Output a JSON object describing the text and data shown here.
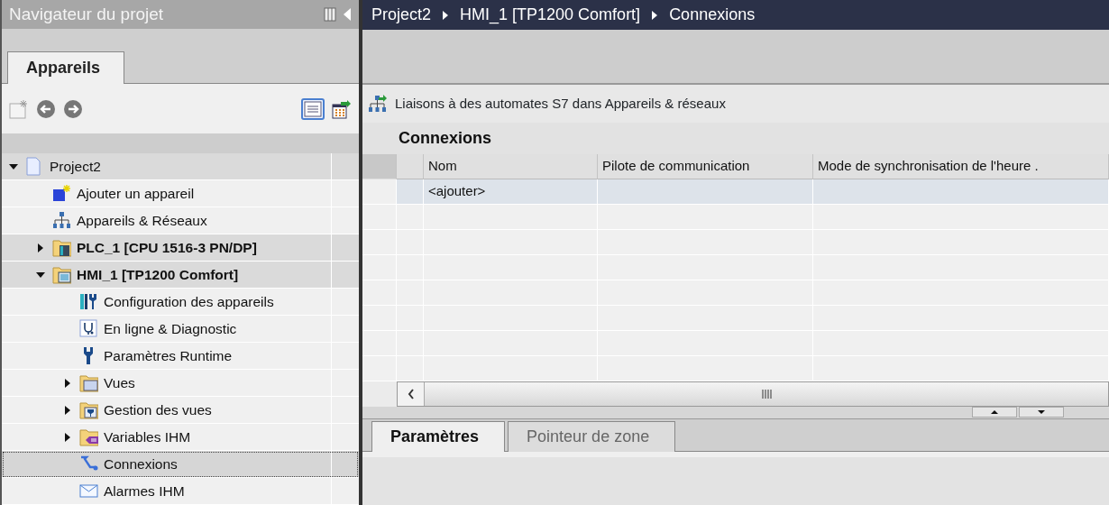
{
  "navigator": {
    "title": "Navigateur du projet",
    "tabs": [
      {
        "label": "Appareils",
        "selected": true
      }
    ],
    "view_toggle": {
      "selected": true
    },
    "tree": [
      {
        "label": "Project2",
        "kind": "project",
        "expanded": true,
        "selected": false,
        "children": [
          {
            "label": "Ajouter un appareil",
            "kind": "add-device",
            "selected": false
          },
          {
            "label": "Appareils & Réseaux",
            "kind": "network",
            "selected": false
          },
          {
            "label": "PLC_1 [CPU 1516-3 PN/DP]",
            "kind": "plc",
            "expanded": false,
            "selected": false
          },
          {
            "label": "HMI_1 [TP1200 Comfort]",
            "kind": "hmi",
            "expanded": true,
            "selected": false,
            "children": [
              {
                "label": "Configuration des appareils",
                "kind": "config",
                "selected": false
              },
              {
                "label": "En ligne & Diagnostic",
                "kind": "diagnostic",
                "selected": false
              },
              {
                "label": "Paramètres Runtime",
                "kind": "runtime",
                "selected": false
              },
              {
                "label": "Vues",
                "kind": "folder-screens",
                "expanded": false,
                "selected": false
              },
              {
                "label": "Gestion des vues",
                "kind": "folder-manage",
                "expanded": false,
                "selected": false
              },
              {
                "label": "Variables IHM",
                "kind": "folder-tags",
                "expanded": false,
                "selected": false
              },
              {
                "label": "Connexions",
                "kind": "connections",
                "selected": true
              },
              {
                "label": "Alarmes IHM",
                "kind": "alarms",
                "selected": false
              }
            ]
          }
        ]
      }
    ]
  },
  "editor": {
    "breadcrumb": [
      "Project2",
      "HMI_1 [TP1200 Comfort]",
      "Connexions"
    ],
    "link": "Liaisons à des automates S7 dans Appareils & réseaux",
    "section_title": "Connexions",
    "table": {
      "columns": [
        "Nom",
        "Pilote de communication",
        "Mode de synchronisation de l'heure ."
      ],
      "rows": [
        [
          "<ajouter>",
          "",
          ""
        ]
      ]
    },
    "bottom_tabs": [
      {
        "label": "Paramètres",
        "selected": true
      },
      {
        "label": "Pointeur de zone",
        "selected": false
      }
    ]
  }
}
